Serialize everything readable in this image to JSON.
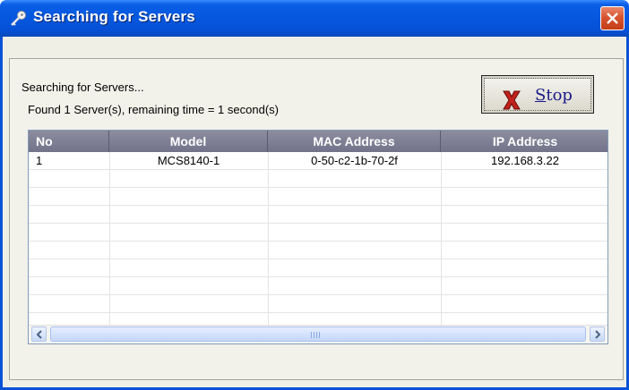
{
  "window": {
    "title": "Searching for Servers"
  },
  "status": {
    "line1": "Searching for Servers...",
    "line2": "Found 1 Server(s), remaining time = 1 second(s)"
  },
  "stop_button": {
    "label_accel": "S",
    "label_rest": "top"
  },
  "table": {
    "columns": [
      "No",
      "Model",
      "MAC Address",
      "IP Address"
    ],
    "rows": [
      [
        "1",
        "MCS8140-1",
        "0-50-c2-1b-70-2f",
        "192.168.3.22"
      ]
    ]
  },
  "colors": {
    "title_bar": "#0557de",
    "header_bg": "#7e7e95",
    "close_button": "#d8542f",
    "stop_x": "#c0221b"
  },
  "icons": [
    "key-icon",
    "close-icon",
    "stop-x-icon",
    "scroll-left-icon",
    "scroll-right-icon"
  ]
}
